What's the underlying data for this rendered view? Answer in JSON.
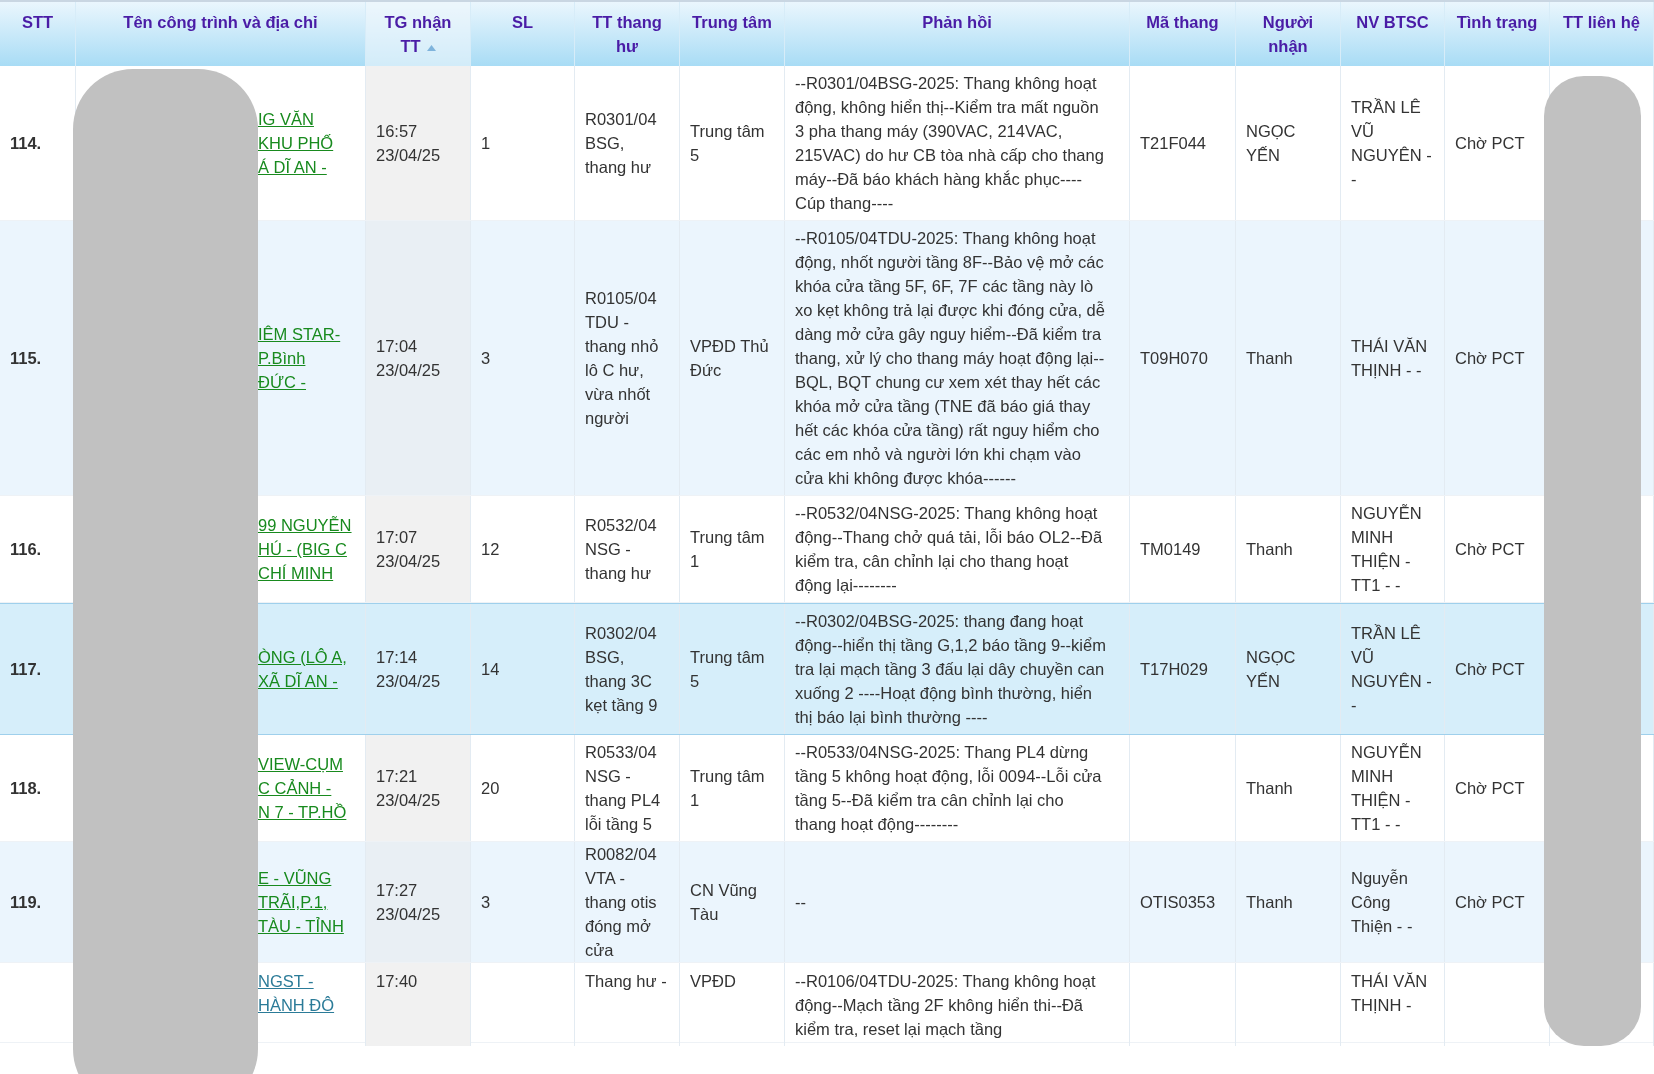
{
  "columns": [
    {
      "label": "STT",
      "sorted": false
    },
    {
      "label": "Tên công trình và địa chỉ",
      "sorted": false
    },
    {
      "label": "TG nhận TT",
      "sorted": true
    },
    {
      "label": "SL",
      "sorted": false
    },
    {
      "label": "TT thang hư",
      "sorted": false
    },
    {
      "label": "Trung tâm",
      "sorted": false
    },
    {
      "label": "Phản hồi",
      "sorted": false
    },
    {
      "label": "Mã thang",
      "sorted": false
    },
    {
      "label": "Người nhận",
      "sorted": false
    },
    {
      "label": "NV BTSC",
      "sorted": false
    },
    {
      "label": "Tình trạng",
      "sorted": false
    },
    {
      "label": "TT liên hệ",
      "sorted": false
    }
  ],
  "rows": [
    {
      "stt": "114.",
      "name": [
        "IG VĂN",
        "KHU PHỐ",
        "Á DĨ AN -"
      ],
      "visited": false,
      "time": "16:57",
      "date": "23/04/25",
      "sl": "1",
      "tt_thang": "R0301/04 BSG, thang hư",
      "trung_tam": "Trung tâm 5",
      "phan_hoi": "--R0301/04BSG-2025: Thang không hoạt động, không hiển thị--Kiểm tra mất nguồn 3 pha thang máy (390VAC, 214VAC, 215VAC) do hư CB tòa nhà cấp cho thang máy--Đã báo khách hàng khắc phục----Cúp thang----",
      "ma_thang": "T21F044",
      "nguoi_nhan": "NGỌC YẾN",
      "nv_btsc": "TRẦN LÊ VŨ NGUYÊN - -",
      "tinh_trang": "Chờ PCT",
      "selected": false
    },
    {
      "stt": "115.",
      "name": [
        "IÊM STAR-",
        "P.Bình",
        "ĐỨC -"
      ],
      "visited": false,
      "time": "17:04",
      "date": "23/04/25",
      "sl": "3",
      "tt_thang": "R0105/04 TDU - thang nhỏ lô C hư, vừa nhốt người",
      "trung_tam": "VPĐD Thủ Đức",
      "phan_hoi": "--R0105/04TDU-2025: Thang không hoạt động, nhốt người tầng 8F--Bảo vệ mở các khóa cửa tầng 5F, 6F, 7F các tầng này lò xo kẹt không trả lại được khi đóng cửa, dễ dàng mở cửa gây nguy hiểm--Đã kiểm tra thang, xử lý cho thang máy hoạt động lại--BQL, BQT chung cư xem xét thay hết các khóa mở cửa tầng (TNE đã báo giá thay hết các khóa cửa tầng) rất nguy hiểm cho các em nhỏ và người lớn khi chạm vào cửa khi không được khóa------",
      "ma_thang": "T09H070",
      "nguoi_nhan": "Thanh",
      "nv_btsc": "THÁI VĂN THỊNH - -",
      "tinh_trang": "Chờ PCT",
      "selected": false
    },
    {
      "stt": "116.",
      "name": [
        "99 NGUYỄN",
        "HÚ - (BIG C",
        "CHÍ MINH"
      ],
      "visited": false,
      "time": "17:07",
      "date": "23/04/25",
      "sl": "12",
      "tt_thang": "R0532/04 NSG - thang hư",
      "trung_tam": "Trung tâm 1",
      "phan_hoi": "--R0532/04NSG-2025: Thang không hoạt động--Thang chở quá tải, lỗi báo OL2--Đã kiểm tra, cân chỉnh lại cho thang hoạt động lại--------",
      "ma_thang": "TM0149",
      "nguoi_nhan": "Thanh",
      "nv_btsc": "NGUYỄN MINH THIỆN - TT1 - -",
      "tinh_trang": "Chờ PCT",
      "selected": false
    },
    {
      "stt": "117.",
      "name": [
        "ÒNG (LÔ A,",
        "XÃ DĨ AN -"
      ],
      "visited": false,
      "time": "17:14",
      "date": "23/04/25",
      "sl": "14",
      "tt_thang": "R0302/04 BSG, thang 3C kẹt tầng 9",
      "trung_tam": "Trung tâm 5",
      "phan_hoi": "--R0302/04BSG-2025: thang đang hoạt động--hiển thị tầng G,1,2 báo tầng 9--kiểm tra lại mạch tầng 3 đấu lại dây chuyền can xuống 2 ----Hoạt động bình thường, hiển thị báo lại bình thường ----",
      "ma_thang": "T17H029",
      "nguoi_nhan": "NGỌC YẾN",
      "nv_btsc": "TRẦN LÊ VŨ NGUYÊN - -",
      "tinh_trang": "Chờ PCT",
      "selected": true
    },
    {
      "stt": "118.",
      "name": [
        "VIEW-CỤM",
        "C CẢNH -",
        "N 7 - TP.HỒ"
      ],
      "visited": false,
      "time": "17:21",
      "date": "23/04/25",
      "sl": "20",
      "tt_thang": "R0533/04 NSG - thang PL4 lỗi tầng 5",
      "trung_tam": "Trung tâm 1",
      "phan_hoi": "--R0533/04NSG-2025: Thang PL4 dừng tầng 5 không hoạt động, lỗi 0094--Lỗi cửa tầng 5--Đã kiểm tra cân chỉnh lại cho thang hoạt động--------",
      "nguoi_nhan": "Thanh",
      "nv_btsc": "NGUYỄN MINH THIỆN - TT1 - -",
      "tinh_trang": "Chờ PCT",
      "selected": false
    },
    {
      "stt": "119.",
      "name": [
        "E - VŨNG",
        "TRÃI,P.1,",
        "TÀU - TỈNH"
      ],
      "visited": false,
      "time": "17:27",
      "date": "23/04/25",
      "sl": "3",
      "tt_thang": "R0082/04 VTA - thang otis đóng mở cửa",
      "trung_tam": "CN Vũng Tàu",
      "phan_hoi": "--",
      "ma_thang": "OTIS0353",
      "nguoi_nhan": "Thanh",
      "nv_btsc": "Nguyễn Công Thiện - -",
      "tinh_trang": "Chờ PCT",
      "selected": false
    },
    {
      "name": [
        "NGST -",
        "HÀNH ĐÔ"
      ],
      "visited": true,
      "time": "17:40",
      "tt_thang": "Thang hư -",
      "trung_tam": "VPĐD",
      "phan_hoi": "--R0106/04TDU-2025: Thang không hoạt động--Mạch tầng 2F không hiển thi--Đã kiểm tra, reset lại mạch tầng",
      "nv_btsc": "THÁI VĂN THỊNH -",
      "selected": false
    }
  ]
}
